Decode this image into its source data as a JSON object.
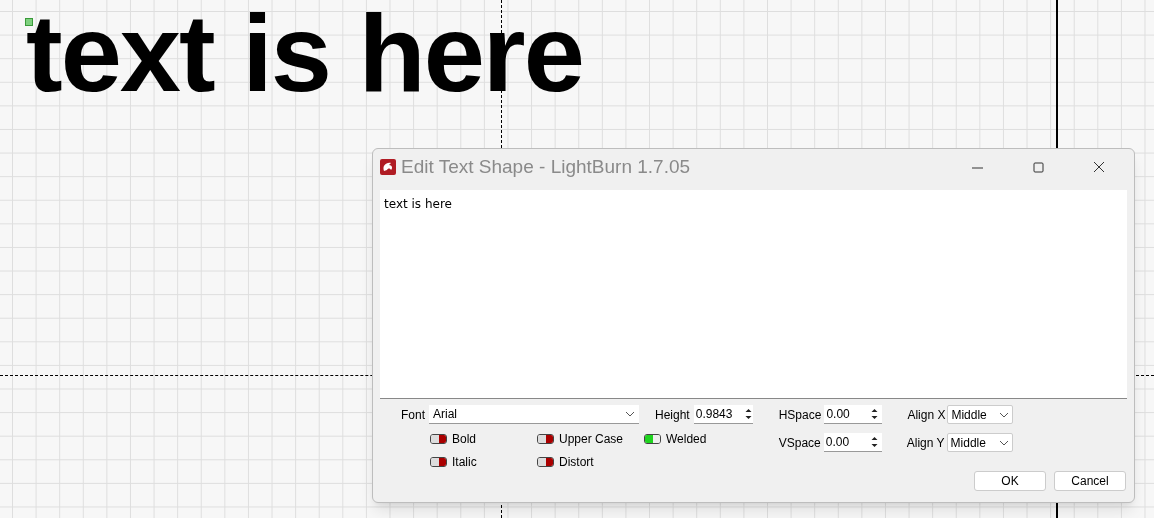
{
  "canvas": {
    "text": "text is here"
  },
  "dialog": {
    "title": "Edit Text Shape - LightBurn 1.7.05",
    "text": "text is here",
    "font": {
      "label": "Font",
      "value": "Arial"
    },
    "height": {
      "label": "Height",
      "value": "0.9843"
    },
    "toggles": [
      {
        "label": "Bold",
        "on": false
      },
      {
        "label": "Upper Case",
        "on": false
      },
      {
        "label": "Welded",
        "on": true
      },
      {
        "label": "Italic",
        "on": false
      },
      {
        "label": "Distort",
        "on": false
      }
    ],
    "spins": [
      {
        "label": "HSpace",
        "value": "0.00"
      },
      {
        "label": "VSpace",
        "value": "0.00"
      }
    ],
    "aligns": [
      {
        "label": "Align X",
        "value": "Middle"
      },
      {
        "label": "Align Y",
        "value": "Middle"
      }
    ],
    "buttons": [
      "OK",
      "Cancel"
    ]
  }
}
